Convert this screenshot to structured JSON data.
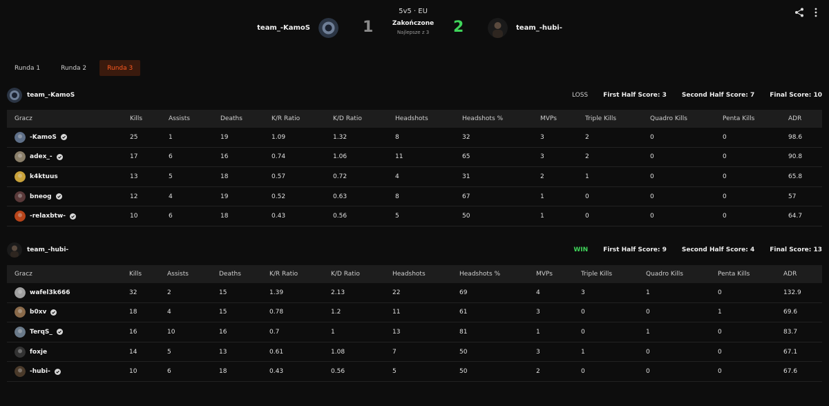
{
  "header": {
    "mode": "5v5 · EU",
    "status": "Zakończone",
    "best_of": "Najlepsze z 3",
    "left_team": "team_-KamoS",
    "right_team": "team_-hubi-",
    "left_score": "1",
    "right_score": "2"
  },
  "tabs": [
    {
      "label": "Runda 1"
    },
    {
      "label": "Runda 2"
    },
    {
      "label": "Runda 3"
    }
  ],
  "active_tab": "Runda 3",
  "columns": [
    "Gracz",
    "Kills",
    "Assists",
    "Deaths",
    "K/R Ratio",
    "K/D Ratio",
    "Headshots",
    "Headshots %",
    "MVPs",
    "Triple Kills",
    "Quadro Kills",
    "Penta Kills",
    "ADR"
  ],
  "teams": [
    {
      "name": "team_-KamoS",
      "result": "LOSS",
      "first_half": "First Half Score: 3",
      "second_half": "Second Half Score: 7",
      "final": "Final Score: 10",
      "players": [
        {
          "name": "-KamoS",
          "verified": true,
          "stats": [
            "25",
            "1",
            "19",
            "1.09",
            "1.32",
            "8",
            "32",
            "3",
            "2",
            "0",
            "0",
            "98.6"
          ]
        },
        {
          "name": "adex_-",
          "verified": true,
          "stats": [
            "17",
            "6",
            "16",
            "0.74",
            "1.06",
            "11",
            "65",
            "3",
            "2",
            "0",
            "0",
            "90.8"
          ]
        },
        {
          "name": "k4ktuus",
          "verified": false,
          "stats": [
            "13",
            "5",
            "18",
            "0.57",
            "0.72",
            "4",
            "31",
            "2",
            "1",
            "0",
            "0",
            "65.8"
          ]
        },
        {
          "name": "bneog",
          "verified": true,
          "stats": [
            "12",
            "4",
            "19",
            "0.52",
            "0.63",
            "8",
            "67",
            "1",
            "0",
            "0",
            "0",
            "57"
          ]
        },
        {
          "name": "-relaxbtw-",
          "verified": true,
          "stats": [
            "10",
            "6",
            "18",
            "0.43",
            "0.56",
            "5",
            "50",
            "1",
            "0",
            "0",
            "0",
            "64.7"
          ]
        }
      ]
    },
    {
      "name": "team_-hubi-",
      "result": "WIN",
      "first_half": "First Half Score: 9",
      "second_half": "Second Half Score: 4",
      "final": "Final Score: 13",
      "players": [
        {
          "name": "wafel3k666",
          "verified": false,
          "stats": [
            "32",
            "2",
            "15",
            "1.39",
            "2.13",
            "22",
            "69",
            "4",
            "3",
            "1",
            "0",
            "132.9"
          ]
        },
        {
          "name": "b0xv",
          "verified": true,
          "stats": [
            "18",
            "4",
            "15",
            "0.78",
            "1.2",
            "11",
            "61",
            "3",
            "0",
            "0",
            "1",
            "69.6"
          ]
        },
        {
          "name": "TerqS_",
          "verified": true,
          "stats": [
            "16",
            "10",
            "16",
            "0.7",
            "1",
            "13",
            "81",
            "1",
            "0",
            "1",
            "0",
            "83.7"
          ]
        },
        {
          "name": "foxje",
          "verified": false,
          "stats": [
            "14",
            "5",
            "13",
            "0.61",
            "1.08",
            "7",
            "50",
            "3",
            "1",
            "0",
            "0",
            "67.1"
          ]
        },
        {
          "name": "-hubi-",
          "verified": true,
          "stats": [
            "10",
            "6",
            "18",
            "0.43",
            "0.56",
            "5",
            "50",
            "2",
            "0",
            "0",
            "0",
            "67.6"
          ]
        }
      ]
    }
  ],
  "colors": {
    "accent": "#ff5a1f",
    "win": "#3fd45a",
    "header_row": "#1d1d1d"
  },
  "icons": [
    "share-icon",
    "more-vert-icon",
    "verified-icon"
  ]
}
